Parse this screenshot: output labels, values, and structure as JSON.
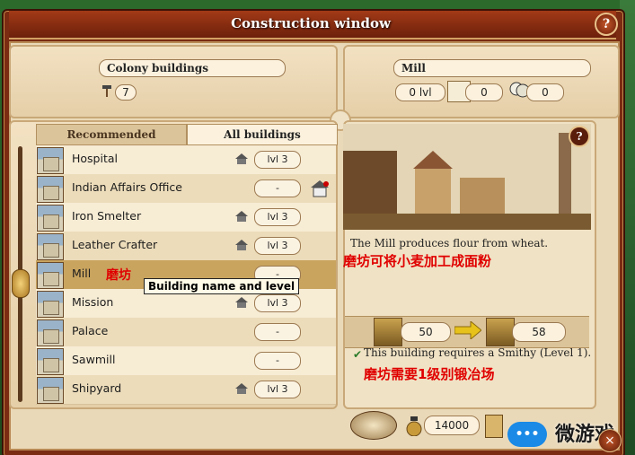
{
  "window": {
    "title": "Construction window",
    "help_icon": "question-mark-icon"
  },
  "left_header": {
    "label": "Colony buildings",
    "count": "7"
  },
  "right_header": {
    "label": "Mill",
    "level": "0 lvl",
    "stat1": "0",
    "stat2": "0"
  },
  "tabs": {
    "recommended": "Recommended",
    "all": "All buildings"
  },
  "buildings": [
    {
      "name": "Hospital",
      "level": "lvl 3",
      "house": true
    },
    {
      "name": "Indian Affairs Office",
      "level": "-",
      "house": false
    },
    {
      "name": "Iron Smelter",
      "level": "lvl 3",
      "house": true
    },
    {
      "name": "Leather Crafter",
      "level": "lvl 3",
      "house": true
    },
    {
      "name": "Mill",
      "level": "-",
      "house": false
    },
    {
      "name": "Mission",
      "level": "lvl 3",
      "house": true
    },
    {
      "name": "Palace",
      "level": "-",
      "house": false
    },
    {
      "name": "Sawmill",
      "level": "-",
      "house": false
    },
    {
      "name": "Shipyard",
      "level": "lvl 3",
      "house": true
    }
  ],
  "mill_annotation": "磨坊",
  "tooltip": "Building name and level",
  "detail": {
    "description": "The Mill produces flour from wheat.",
    "description_cn": "磨坊可将小麦加工成面粉",
    "input_amount": "50",
    "output_amount": "58",
    "requirement": "This building requires a Smithy (Level 1).",
    "requirement_cn": "磨坊需要1级别锻冶场"
  },
  "footer": {
    "cost": "14000"
  },
  "watermark": {
    "text": "微游戏",
    "badge": "•••"
  },
  "colors": {
    "frame": "#7a2b12",
    "panel": "#ead9b8",
    "selected_row": "#c9a45f",
    "annotation": "#e00000"
  }
}
